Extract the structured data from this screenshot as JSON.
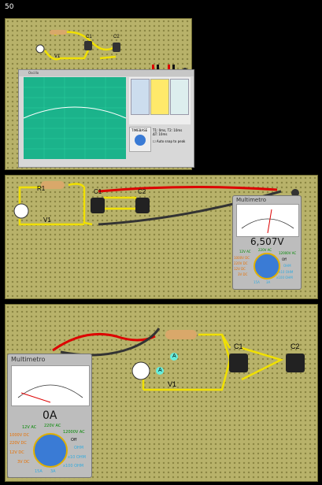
{
  "slide_number": "50",
  "panel1": {
    "components": {
      "c1": "C1",
      "c2": "C2",
      "v1": "V1"
    },
    "oscilloscope": {
      "title": "Oscillo",
      "timebase": "TIMEBASE",
      "ch_labels": [
        "5 V/div",
        "5 V/div",
        "5 V/div"
      ],
      "auto_snap": "Auto snap to peak",
      "measure": "T1: 0ms, T2: 10ms",
      "delta": "ΔT: 10ms",
      "buttons": [
        "Probe",
        "Cursor"
      ]
    }
  },
  "panel2": {
    "components": {
      "r1": "R1",
      "c1": "C1",
      "c2": "C2",
      "v1": "V1"
    },
    "meter": {
      "title": "Multimetro",
      "reading": "6,507V",
      "scale": [
        "0",
        "2",
        "4",
        "6",
        "8",
        "10",
        "12"
      ],
      "labels": [
        "12V AC",
        "220V AC",
        "12000V AC",
        "1000V DC",
        "Off",
        "220V DC",
        "OHM",
        "12V DC",
        "x10 OHM",
        "3V DC",
        "x100 OHM",
        "15A",
        "3A"
      ]
    }
  },
  "panel3": {
    "components": {
      "c1": "C1",
      "c2": "C2",
      "v1": "V1",
      "probe_a": "A",
      "probe_b": "A"
    },
    "meter": {
      "title": "Multimetro",
      "reading": "0A",
      "scale": [
        "0",
        "0.5",
        "1",
        "1.5",
        "2",
        "2.5",
        "3"
      ],
      "labels": [
        "12V AC",
        "220V AC",
        "12000V AC",
        "1000V DC",
        "Off",
        "220V DC",
        "OHM",
        "12V DC",
        "x10 OHM",
        "3V DC",
        "x100 OHM",
        "15A",
        "3A"
      ]
    }
  }
}
